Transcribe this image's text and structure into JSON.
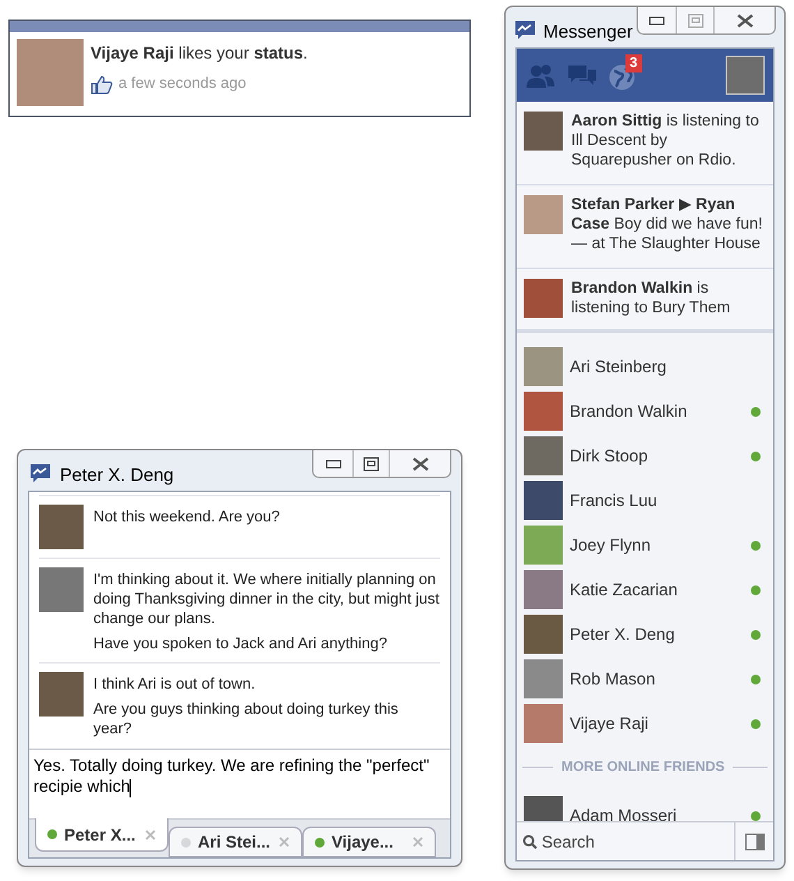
{
  "notification": {
    "text": "**Vijaye Raji** likes your **status**.",
    "time": "a few seconds ago"
  },
  "messenger": {
    "title": "Messenger",
    "header": {
      "badge": "3"
    },
    "ticker": [
      {
        "text": "**Aaron Sittig** is listening to Ill Descent by Squarepusher on Rdio."
      },
      {
        "text": "**Stefan Parker** ▶ **Ryan Case** Boy did we have fun! — at The Slaughter House"
      },
      {
        "text": "**Brandon Walkin** is listening to Bury Them"
      }
    ],
    "friends": [
      {
        "name": "Ari Steinberg",
        "online": false
      },
      {
        "name": "Brandon Walkin",
        "online": true
      },
      {
        "name": "Dirk Stoop",
        "online": true
      },
      {
        "name": "Francis Luu",
        "online": false
      },
      {
        "name": "Joey Flynn",
        "online": true
      },
      {
        "name": "Katie Zacarian",
        "online": true
      },
      {
        "name": "Peter X. Deng",
        "online": true
      },
      {
        "name": "Rob Mason",
        "online": true
      },
      {
        "name": "Vijaye Raji",
        "online": true
      }
    ],
    "section_label": "MORE ONLINE FRIENDS",
    "more_friends": [
      {
        "name": "Adam Mosseri",
        "online": true
      }
    ],
    "search": {
      "placeholder": "Search"
    }
  },
  "chat": {
    "title": "Peter X. Deng",
    "messages": [
      {
        "lines": [
          "Not this weekend. Are you?"
        ]
      },
      {
        "lines": [
          "I'm thinking about it. We where initially planning on doing Thanksgiving dinner in the city, but might just change our plans.",
          "Have you spoken to Jack and Ari anything?"
        ]
      },
      {
        "lines": [
          "I think Ari is out of town.",
          "Are you guys thinking about doing turkey this year?"
        ]
      }
    ],
    "input": {
      "value": "Yes. Totally doing turkey. We are refining the \"perfect\" recipie which"
    },
    "tabs": [
      {
        "label": "Peter X...",
        "online": true,
        "selected": true
      },
      {
        "label": "Ari Stei...",
        "online": false,
        "selected": false
      },
      {
        "label": "Vijaye...",
        "online": true,
        "selected": false
      }
    ]
  }
}
